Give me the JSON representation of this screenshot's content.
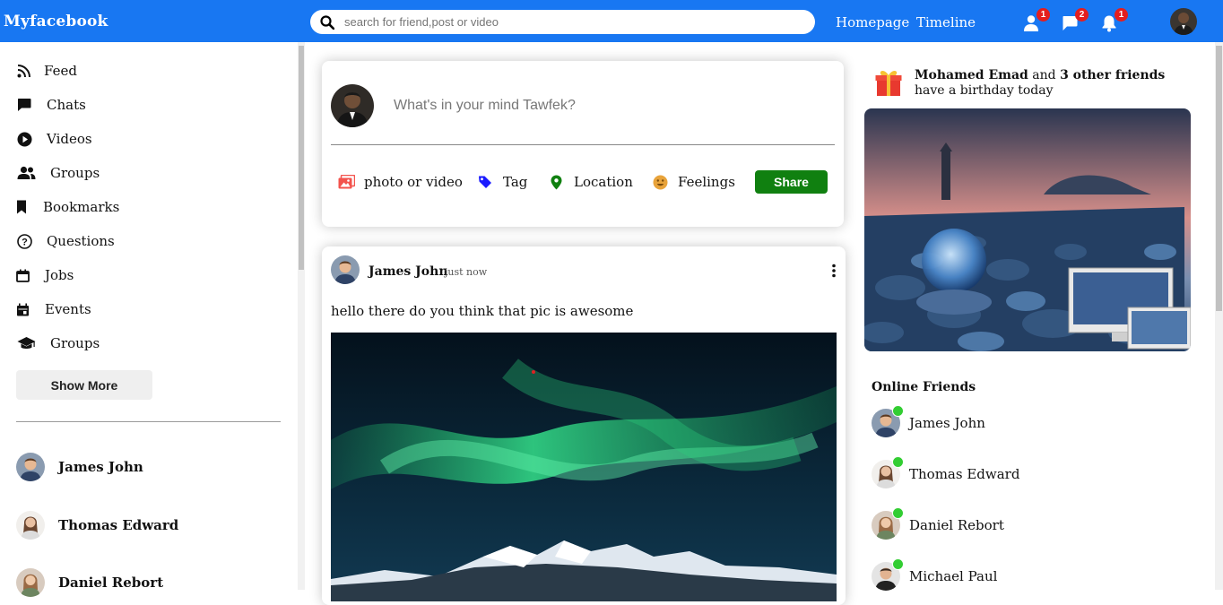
{
  "colors": {
    "brand": "#1877f2",
    "share": "#108010",
    "badge": "#e41e1e",
    "online": "#32cd32"
  },
  "topbar": {
    "logo": "Myfacebook",
    "search": {
      "placeholder": "search for friend,post or video",
      "icon": "search-icon"
    },
    "links": [
      "Homepage",
      "Timeline"
    ],
    "notifications": [
      {
        "icon": "person-icon",
        "count": "1"
      },
      {
        "icon": "chat-icon",
        "count": "2"
      },
      {
        "icon": "bell-icon",
        "count": "1"
      }
    ]
  },
  "sidebar": {
    "items": [
      {
        "icon": "rss-feed-icon",
        "label": "Feed"
      },
      {
        "icon": "chat-icon",
        "label": "Chats"
      },
      {
        "icon": "play-circle-icon",
        "label": "Videos"
      },
      {
        "icon": "group-icon",
        "label": "Groups"
      },
      {
        "icon": "bookmark-icon",
        "label": "Bookmarks"
      },
      {
        "icon": "help-circle-icon",
        "label": "Questions"
      },
      {
        "icon": "work-outline-icon",
        "label": "Jobs"
      },
      {
        "icon": "event-icon",
        "label": "Events"
      },
      {
        "icon": "school-icon",
        "label": "Groups"
      }
    ],
    "show_more": "Show More",
    "friends": [
      "James John",
      "Thomas Edward",
      "Daniel Rebort"
    ]
  },
  "composer": {
    "placeholder": "What's in your mind Tawfek?",
    "options": [
      {
        "icon": "photo-icon",
        "label": "photo or video",
        "color": "#f3534d"
      },
      {
        "icon": "tag-icon",
        "label": "Tag",
        "color": "#1a1aff"
      },
      {
        "icon": "location-icon",
        "label": "Location",
        "color": "#108010"
      },
      {
        "icon": "emoji-icon",
        "label": "Feelings",
        "color": "#e8a33a"
      }
    ],
    "share": "Share"
  },
  "post": {
    "author": "James John",
    "time": "just now",
    "text": "hello there do you think that pic is awesome",
    "image": "aurora-landscape"
  },
  "right": {
    "birthday": {
      "name": "Mohamed Emad",
      "mid": " and ",
      "others": "3 other friends",
      "tail": " have a birthday today"
    },
    "online_title": "Online Friends",
    "online": [
      "James John",
      "Thomas Edward",
      "Daniel Rebort",
      "Michael Paul"
    ]
  }
}
